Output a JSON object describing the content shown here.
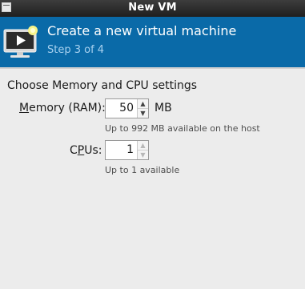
{
  "window": {
    "title": "New VM"
  },
  "header": {
    "title": "Create a new virtual machine",
    "step": "Step 3 of 4",
    "icon": "computer-play-icon"
  },
  "section": {
    "heading": "Choose Memory and CPU settings"
  },
  "memory": {
    "label_mnemonic": "M",
    "label_rest": "emory (RAM):",
    "value": "50",
    "unit": "MB",
    "hint": "Up to 992 MB available on the host"
  },
  "cpus": {
    "label_pre": "C",
    "label_mnemonic": "P",
    "label_post": "Us:",
    "value": "1",
    "hint": "Up to 1 available"
  },
  "colors": {
    "header_bg": "#0a6aa8",
    "step_text": "#a9d2f0",
    "titlebar_bg": "#2e2e2e",
    "window_bg": "#ececec"
  }
}
